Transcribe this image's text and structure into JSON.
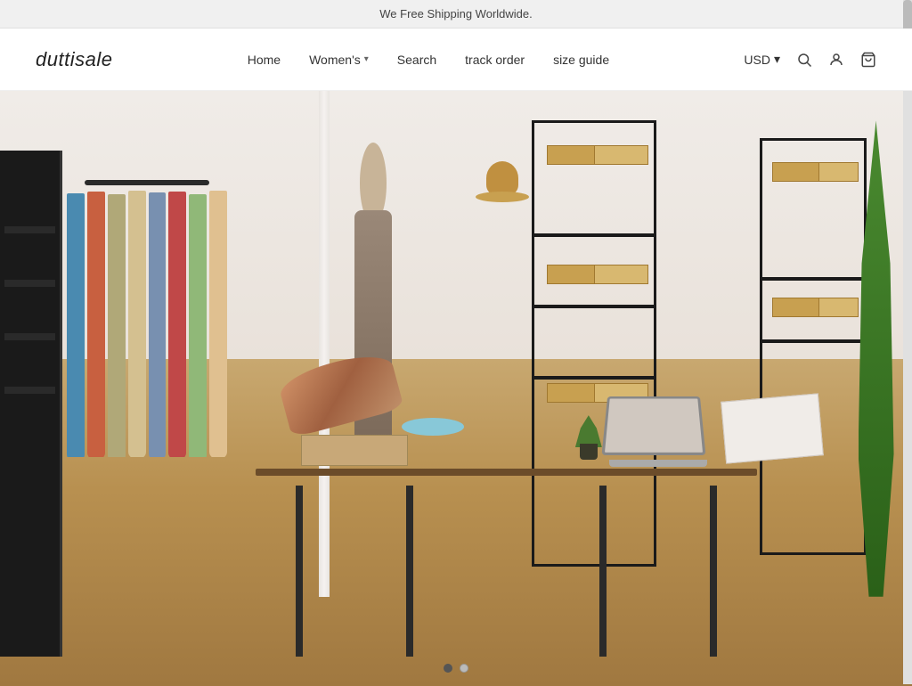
{
  "announcement": {
    "text": "We Free Shipping Worldwide."
  },
  "header": {
    "logo": "duttisale",
    "nav": [
      {
        "id": "home",
        "label": "Home",
        "hasDropdown": false
      },
      {
        "id": "womens",
        "label": "Women's",
        "hasDropdown": true
      },
      {
        "id": "search",
        "label": "Search",
        "hasDropdown": false
      },
      {
        "id": "track-order",
        "label": "track order",
        "hasDropdown": false
      },
      {
        "id": "size-guide",
        "label": "size guide",
        "hasDropdown": false
      }
    ],
    "currency": {
      "value": "USD",
      "chevron": "▾"
    },
    "icons": {
      "search": "🔍",
      "account": "👤",
      "cart": "🛒"
    }
  },
  "hero": {
    "slide_count": 2,
    "active_slide": 0
  },
  "slide_indicators": [
    {
      "id": "slide-1",
      "active": true
    },
    {
      "id": "slide-2",
      "active": false
    }
  ]
}
